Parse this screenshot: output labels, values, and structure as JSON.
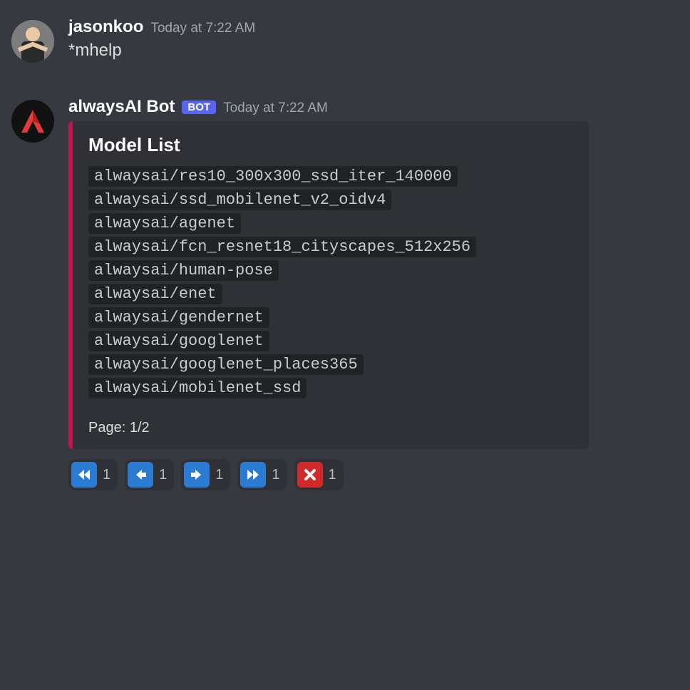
{
  "messages": [
    {
      "author": "jasonkoo",
      "timestamp": "Today at 7:22 AM",
      "text": "*mhelp"
    },
    {
      "author": "alwaysAI Bot",
      "bot_tag": "BOT",
      "timestamp": "Today at 7:22 AM",
      "embed": {
        "accent_color": "#bf1650",
        "title": "Model List",
        "models": [
          "alwaysai/res10_300x300_ssd_iter_140000",
          "alwaysai/ssd_mobilenet_v2_oidv4",
          "alwaysai/agenet",
          "alwaysai/fcn_resnet18_cityscapes_512x256",
          "alwaysai/human-pose",
          "alwaysai/enet",
          "alwaysai/gendernet",
          "alwaysai/googlenet",
          "alwaysai/googlenet_places365",
          "alwaysai/mobilenet_ssd"
        ],
        "footer": "Page: 1/2"
      },
      "reactions": [
        {
          "icon": "rewind",
          "count": "1"
        },
        {
          "icon": "back",
          "count": "1"
        },
        {
          "icon": "forward",
          "count": "1"
        },
        {
          "icon": "fast-forward",
          "count": "1"
        },
        {
          "icon": "close",
          "count": "1"
        }
      ]
    }
  ]
}
